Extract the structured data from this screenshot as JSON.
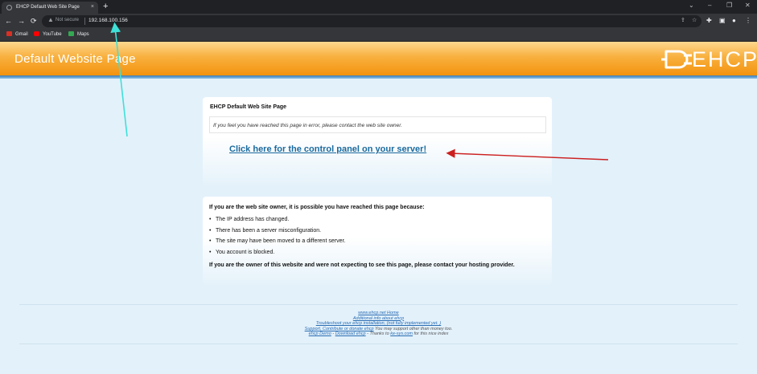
{
  "browser": {
    "tab_title": "EHCP Default Web Site Page",
    "tab_close": "×",
    "new_tab": "+",
    "window_controls": [
      "⌄",
      "–",
      "❐",
      "✕"
    ],
    "nav": {
      "back": "←",
      "forward": "→",
      "reload": "⟳"
    },
    "security_label": "Not secure",
    "url": "192.168.100.156",
    "bookmarks": [
      {
        "label": "Gmail",
        "color": "#d93025"
      },
      {
        "label": "YouTube",
        "color": "#ff0000"
      },
      {
        "label": "Maps",
        "color": "#34a853"
      }
    ]
  },
  "header": {
    "site_title": "Default Website Page",
    "logo_text": "EHCP"
  },
  "top_panel": {
    "title": "EHCP Default Web Site Page",
    "notice": "If you feel you have reached this page in error, please contact the web site owner.",
    "control_panel_link": "Click here for the control panel on your server!"
  },
  "bottom_panel": {
    "heading": "If you are the web site owner, it is possible you have reached this page because:",
    "reasons": [
      "The IP address has changed.",
      "There has been a server misconfiguration.",
      "The site may have been moved to a different server.",
      "You account is blocked."
    ],
    "footer_note": "If you are the owner of this website and were not expecting to see this page, please contact your hosting provider."
  },
  "footer": {
    "home_link": "www.ehcp.net Home",
    "about_link": "Additional info about ehcp",
    "troubleshoot_link": "Troubleshoot your ehcp installation, (not fully implemented yet. )",
    "support_link": "Support, Contribute or donate ehcp",
    "support_note": " You may support other than money too.",
    "demo_link": "ehcp Demo",
    "sep": " - ",
    "download_link": "Download ehcp",
    "thanks_text": " - Thanks to ",
    "kesys_link": "ke-sys.com",
    "thanks_tail": " for this nice index"
  },
  "colors": {
    "annotation_arrow_cyan": "#3fe0d8",
    "annotation_arrow_red": "#cc1f1f",
    "link": "#1a6a9e"
  }
}
